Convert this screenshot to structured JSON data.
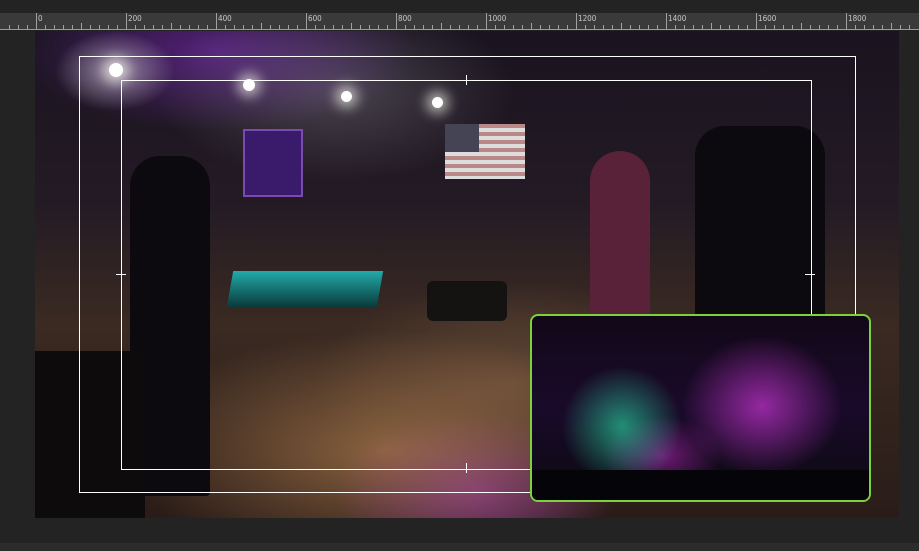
{
  "ruler": {
    "labels": [
      "0",
      "200",
      "400",
      "600",
      "800",
      "1000",
      "1200",
      "1400",
      "1600",
      "1800"
    ]
  },
  "preview": {
    "title_safe_frame": true,
    "action_safe_frame": true,
    "picture_in_picture_border_color": "#7bd23c"
  },
  "colors": {
    "background": "#232323",
    "ruler": "#3a3a3a",
    "pip_border": "#7bd23c"
  }
}
